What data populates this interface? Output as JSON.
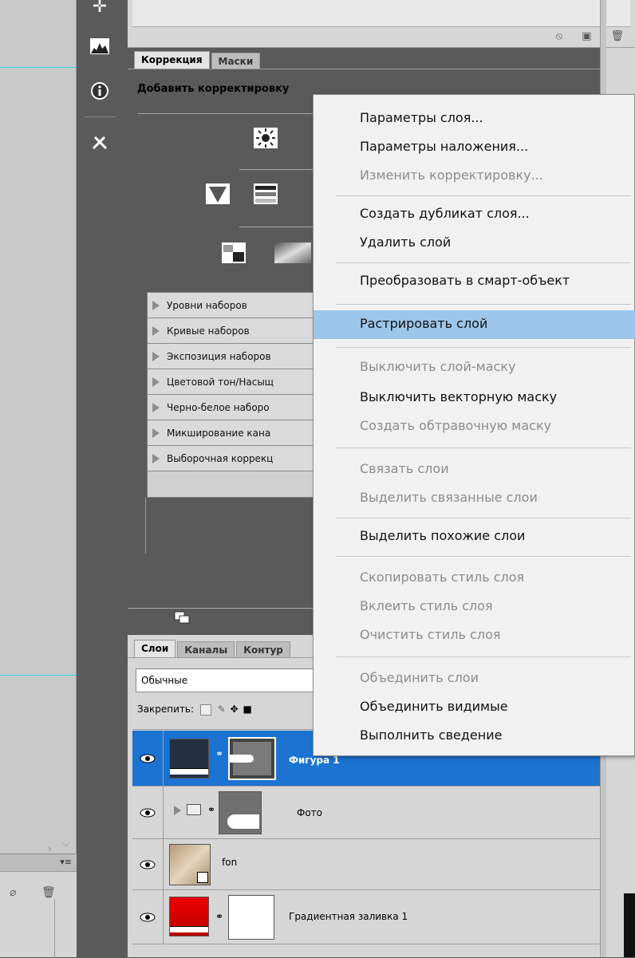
{
  "correction_panel": {
    "tabs": [
      "Коррекция",
      "Маски"
    ],
    "heading": "Добавить корректировку",
    "presets": [
      "Уровни наборов",
      "Кривые наборов",
      "Экспозиция наборов",
      "Цветовой тон/Насыщ",
      "Черно-белое наборо",
      "Микширование кана",
      "Выборочная коррекц"
    ]
  },
  "layers_panel": {
    "tabs": [
      "Слои",
      "Каналы",
      "Контур"
    ],
    "blend_mode": "Обычные",
    "lock_label": "Закрепить:",
    "layers": [
      {
        "name": "Фигура 1",
        "selected": true
      },
      {
        "name": "Фото",
        "selected": false
      },
      {
        "name": "fon",
        "selected": false
      },
      {
        "name": "Градиентная заливка 1",
        "selected": false
      }
    ]
  },
  "context_menu": {
    "items": [
      {
        "label": "Параметры слоя...",
        "enabled": true
      },
      {
        "label": "Параметры наложения...",
        "enabled": true
      },
      {
        "label": "Изменить корректировку...",
        "enabled": false
      },
      {
        "label": "Создать дубликат слоя...",
        "enabled": true
      },
      {
        "label": "Удалить слой",
        "enabled": true
      },
      {
        "label": "Преобразовать в смарт-объект",
        "enabled": true
      },
      {
        "label": "Растрировать слой",
        "enabled": true,
        "highlighted": true
      },
      {
        "label": "Выключить слой-маску",
        "enabled": false
      },
      {
        "label": "Выключить векторную маску",
        "enabled": true
      },
      {
        "label": "Создать обтравочную маску",
        "enabled": false
      },
      {
        "label": "Связать слои",
        "enabled": false
      },
      {
        "label": "Выделить связанные слои",
        "enabled": false
      },
      {
        "label": "Выделить похожие слои",
        "enabled": true
      },
      {
        "label": "Скопировать стиль слоя",
        "enabled": false
      },
      {
        "label": "Вклеить стиль слоя",
        "enabled": false
      },
      {
        "label": "Очистить стиль слоя",
        "enabled": false
      },
      {
        "label": "Объединить слои",
        "enabled": false
      },
      {
        "label": "Объединить видимые",
        "enabled": true
      },
      {
        "label": "Выполнить сведение",
        "enabled": true
      }
    ]
  },
  "colors": {
    "selection": "#1c73d2",
    "menu_highlight": "#9cc6ea",
    "guide": "#31d6d6"
  }
}
